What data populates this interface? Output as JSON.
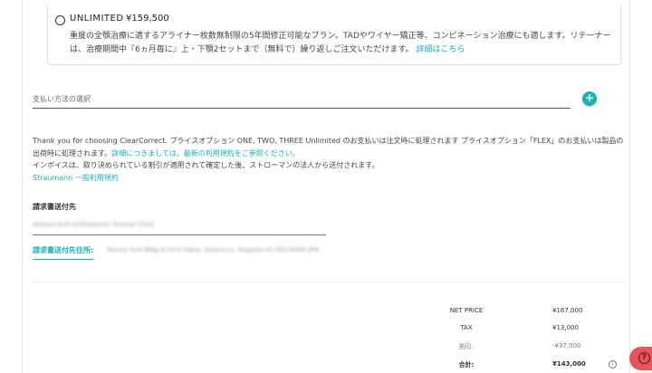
{
  "plan": {
    "name": "UNLIMITED",
    "price": "¥159,500",
    "description": "重度の全顎治療に適するアライナー枚数無制限の5年間修正可能なプラン。TADやワイヤー矯正等、コンビネーション治療にも適します。リテーナーは、治療期間中『6ヵ月毎に』上・下顎2セットまで（無料で）繰り返しご注文いただけます。",
    "details_link": "詳細はこちら"
  },
  "payment": {
    "select_label": "支払い方法の選択",
    "add_button": "+"
  },
  "notice": {
    "line1": "Thank you for choosing ClearCorrect. プライスオプション ONE, TWO, THREE Unlimited のお支払いは注文時に処理されます プライスオプション「FLEX」のお支払いは製品の出荷時に処理されます。",
    "line1_link": "詳細につきましては、最新の利用規約をご参照ください。",
    "line2": "インボイスは、取り決められている割引が適用されて確定した後、ストローマンの法人から送付されます。",
    "terms_link": "Straumann 一般利用規約"
  },
  "billing": {
    "title": "請求書送付先",
    "name_value": "Kokoyo Kuhl Orthodontic Dentist Clinic",
    "address_label": "請求書送付先住所:",
    "address_value": "Ozuna Fuld Bldg 8-14-5 Sakaj, Osaka-nu, Nagoya-shi 453-8900 JPN"
  },
  "summary": [
    {
      "label": "NET PRICE",
      "value": "¥167,000",
      "style": "normal"
    },
    {
      "label": "TAX",
      "value": "¥13,000",
      "style": "normal"
    },
    {
      "label": "割引:",
      "value": "-¥37,000",
      "style": "discount"
    },
    {
      "label": "合計:",
      "value": "¥143,000",
      "style": "bold"
    }
  ],
  "icons": {
    "info": "i",
    "help": "?"
  },
  "colors": {
    "accent": "#18aeb9",
    "help_button": "#e9535b"
  }
}
